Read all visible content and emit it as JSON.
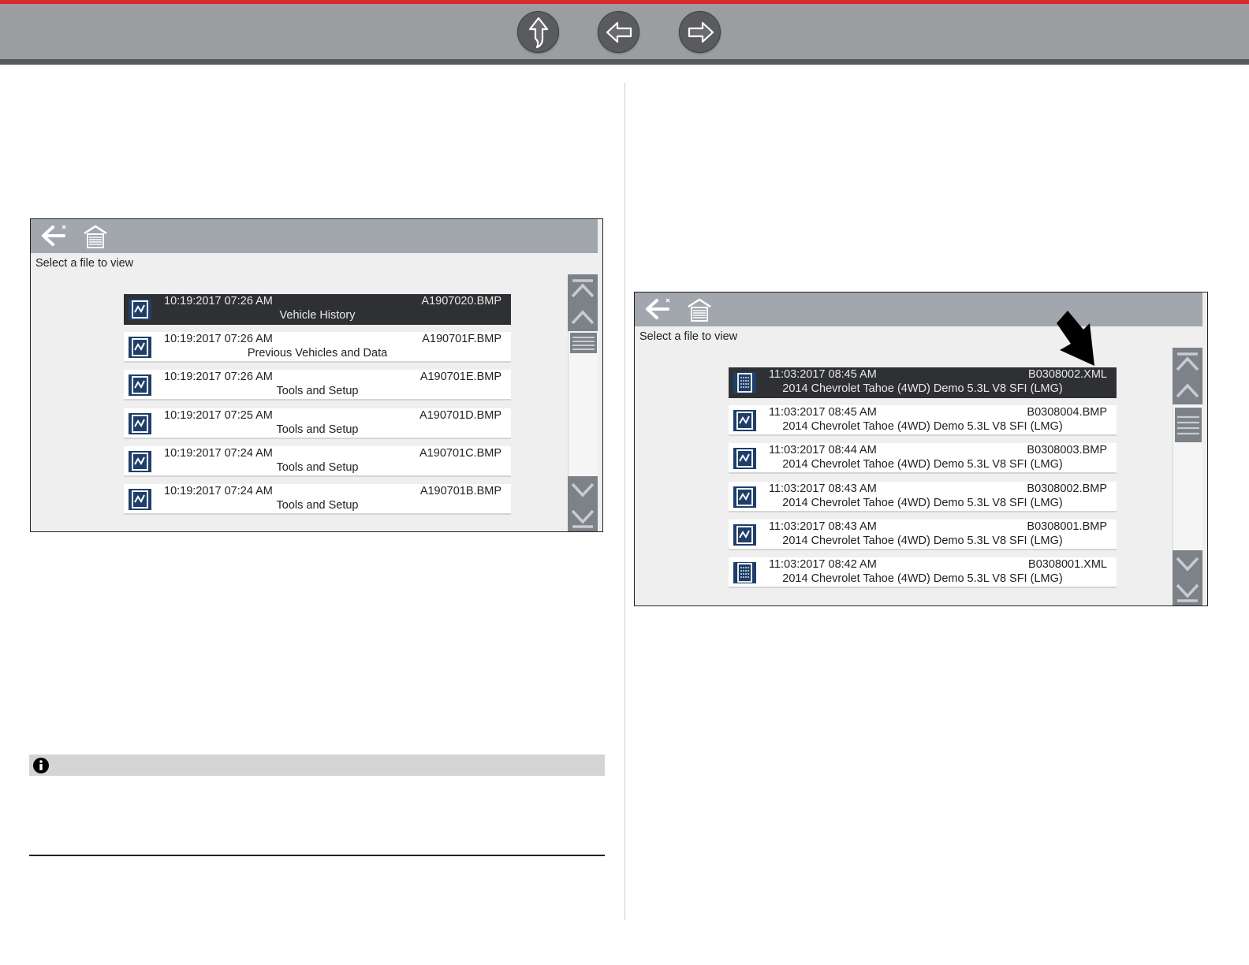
{
  "nav": {
    "buttons": [
      {
        "name": "up-icon"
      },
      {
        "name": "arrow-left-icon"
      },
      {
        "name": "arrow-right-icon"
      }
    ]
  },
  "left_screen": {
    "prompt": "Select a file to view",
    "rows": [
      {
        "datetime": "10:19:2017 07:26 AM",
        "filename": "A1907020.BMP",
        "description": "Vehicle History",
        "icon": "image-file-icon",
        "selected": true
      },
      {
        "datetime": "10:19:2017 07:26 AM",
        "filename": "A190701F.BMP",
        "description": "Previous Vehicles and Data",
        "icon": "image-file-icon",
        "selected": false
      },
      {
        "datetime": "10:19:2017 07:26 AM",
        "filename": "A190701E.BMP",
        "description": "Tools and Setup",
        "icon": "image-file-icon",
        "selected": false
      },
      {
        "datetime": "10:19:2017 07:25 AM",
        "filename": "A190701D.BMP",
        "description": "Tools and Setup",
        "icon": "image-file-icon",
        "selected": false
      },
      {
        "datetime": "10:19:2017 07:24 AM",
        "filename": "A190701C.BMP",
        "description": "Tools and Setup",
        "icon": "image-file-icon",
        "selected": false
      },
      {
        "datetime": "10:19:2017 07:24 AM",
        "filename": "A190701B.BMP",
        "description": "Tools and Setup",
        "icon": "image-file-icon",
        "selected": false
      }
    ]
  },
  "right_screen": {
    "prompt": "Select a file to view",
    "rows": [
      {
        "datetime": "11:03:2017 08:45 AM",
        "filename": "B0308002.XML",
        "description": "2014 Chevrolet Tahoe (4WD) Demo 5.3L V8 SFI (LMG)",
        "icon": "data-file-icon",
        "selected": true
      },
      {
        "datetime": "11:03:2017 08:45 AM",
        "filename": "B0308004.BMP",
        "description": "2014 Chevrolet Tahoe (4WD) Demo 5.3L V8 SFI (LMG)",
        "icon": "image-file-icon",
        "selected": false
      },
      {
        "datetime": "11:03:2017 08:44 AM",
        "filename": "B0308003.BMP",
        "description": "2014 Chevrolet Tahoe (4WD) Demo 5.3L V8 SFI (LMG)",
        "icon": "image-file-icon",
        "selected": false
      },
      {
        "datetime": "11:03:2017 08:43 AM",
        "filename": "B0308002.BMP",
        "description": "2014 Chevrolet Tahoe (4WD) Demo 5.3L V8 SFI (LMG)",
        "icon": "image-file-icon",
        "selected": false
      },
      {
        "datetime": "11:03:2017 08:43 AM",
        "filename": "B0308001.BMP",
        "description": "2014 Chevrolet Tahoe (4WD) Demo 5.3L V8 SFI (LMG)",
        "icon": "image-file-icon",
        "selected": false
      },
      {
        "datetime": "11:03:2017 08:42 AM",
        "filename": "B0308001.XML",
        "description": "2014 Chevrolet Tahoe (4WD) Demo 5.3L V8 SFI (LMG)",
        "icon": "data-file-icon",
        "selected": false
      }
    ]
  },
  "colors": {
    "accent_red": "#d62a30",
    "toolbar_gray": "#a2a6ad",
    "selected_row": "#2f3034",
    "file_icon_blue": "#1f3f6a"
  }
}
